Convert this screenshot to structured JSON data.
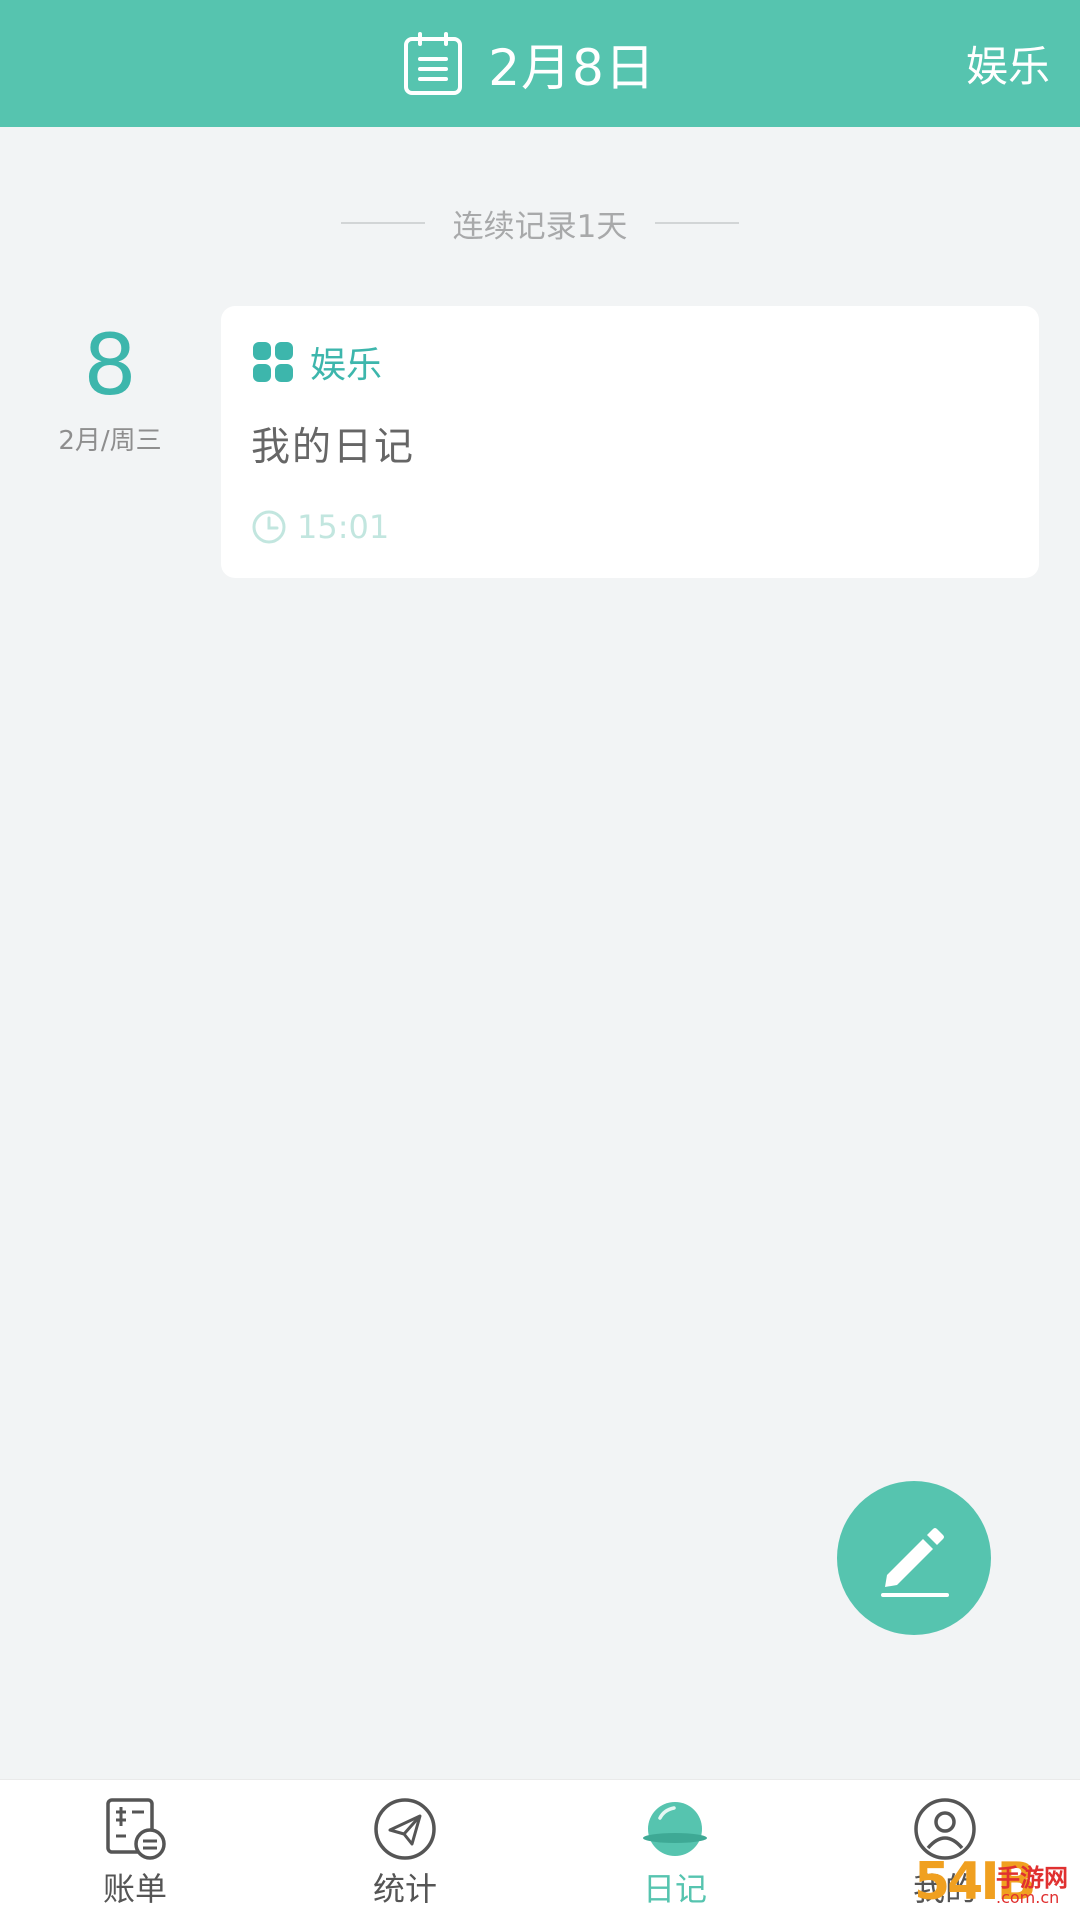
{
  "header": {
    "title": "2月8日",
    "right_label": "娱乐"
  },
  "streak": {
    "text": "连续记录1天"
  },
  "entry": {
    "day": "8",
    "subdate": "2月/周三",
    "category": "娱乐",
    "text": "我的日记",
    "time": "15:01"
  },
  "tabs": [
    {
      "label": "账单",
      "icon": "bill-icon"
    },
    {
      "label": "统计",
      "icon": "paper-plane-icon"
    },
    {
      "label": "日记",
      "icon": "diary-ball-icon",
      "active": true
    },
    {
      "label": "我的",
      "icon": "user-icon"
    }
  ],
  "watermark": {
    "num": "54IB",
    "a": "手游网",
    "b": ".com.cn"
  },
  "colors": {
    "accent": "#56c4af",
    "teal_text": "#3db6ac",
    "background": "#f2f4f5"
  }
}
